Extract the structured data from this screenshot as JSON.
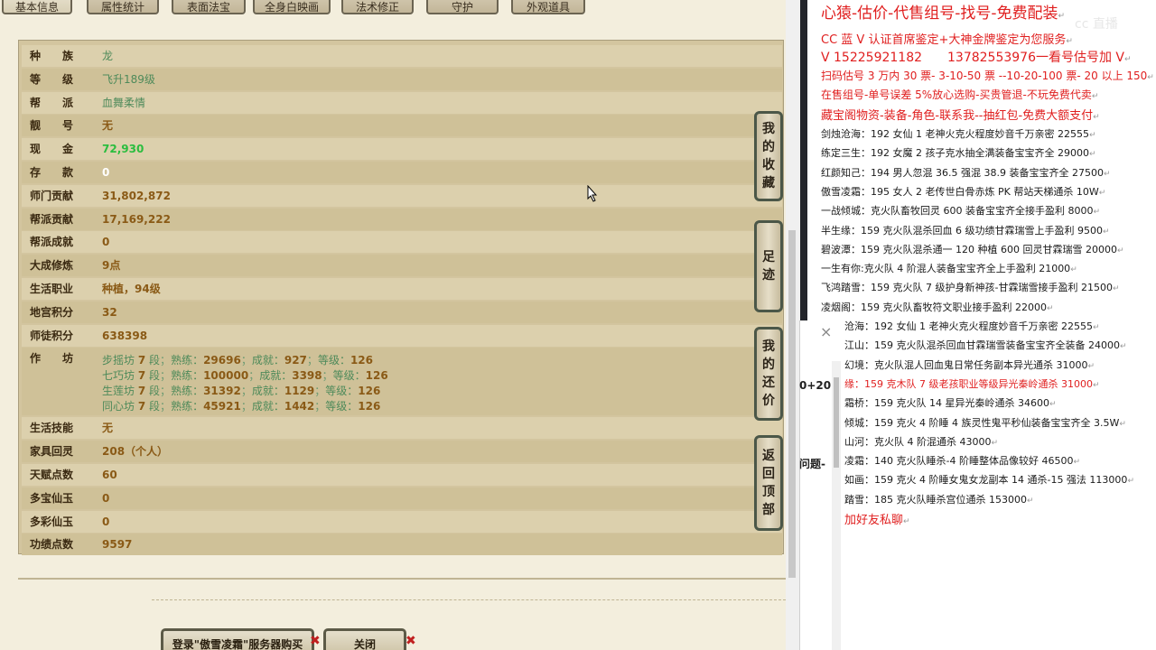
{
  "tabs": [
    "基本信息",
    "属性统计",
    "表面法宝",
    "全身白映画",
    "法术修正",
    "守护",
    "外观道具"
  ],
  "stats": [
    {
      "label": "种　　族",
      "value": "龙",
      "style": "teal"
    },
    {
      "label": "等　　级",
      "value": "飞升189级",
      "style": "teal"
    },
    {
      "label": "帮　　派",
      "value": "血舞柔情",
      "style": "teal"
    },
    {
      "label": "靓　　号",
      "value": "无",
      "style": "brown"
    },
    {
      "label": "现　　金",
      "value": "72,930",
      "style": "green"
    },
    {
      "label": "存　　款",
      "value": "0",
      "style": "white"
    },
    {
      "label": "师门贡献",
      "value": "31,802,872",
      "style": "brown"
    },
    {
      "label": "帮派贡献",
      "value": "17,169,222",
      "style": "brown"
    },
    {
      "label": "帮派成就",
      "value": "0",
      "style": "brown"
    },
    {
      "label": "大成修炼",
      "value": "9点",
      "style": "brown"
    },
    {
      "label": "生活职业",
      "value": "种植，94级",
      "style": "brown"
    },
    {
      "label": "地宫积分",
      "value": "32",
      "style": "brown"
    },
    {
      "label": "师徒积分",
      "value": "638398",
      "style": "brown"
    }
  ],
  "workshop": {
    "label": "作　　坊",
    "lines": [
      {
        "name": "步摇坊",
        "dan": "7",
        "shulian": "29696",
        "chengjiu": "927",
        "dengji": "126"
      },
      {
        "name": "七巧坊",
        "dan": "7",
        "shulian": "100000",
        "chengjiu": "3398",
        "dengji": "126"
      },
      {
        "name": "生莲坊",
        "dan": "7",
        "shulian": "31392",
        "chengjiu": "1129",
        "dengji": "126"
      },
      {
        "name": "同心坊",
        "dan": "7",
        "shulian": "45921",
        "chengjiu": "1442",
        "dengji": "126"
      }
    ],
    "word_dan": "段",
    "word_shulian": "熟练：",
    "word_chengjiu": "成就：",
    "word_dengji": "等级："
  },
  "stats2": [
    {
      "label": "生活技能",
      "value": "无"
    },
    {
      "label": "家具回灵",
      "value": "208（个人）"
    },
    {
      "label": "天赋点数",
      "value": "60"
    },
    {
      "label": "多宝仙玉",
      "value": "0"
    },
    {
      "label": "多彩仙玉",
      "value": "0"
    },
    {
      "label": "功绩点数",
      "value": "9597"
    }
  ],
  "side_buttons": [
    {
      "name": "my-favorites-button",
      "text": [
        "我",
        "的",
        "收",
        "藏"
      ]
    },
    {
      "name": "footprint-button",
      "text": [
        "足",
        "迹"
      ]
    },
    {
      "name": "my-counteroffer-button",
      "text": [
        "我",
        "的",
        "还",
        "价"
      ]
    },
    {
      "name": "back-to-top-button",
      "text": [
        "返",
        "回",
        "顶",
        "部"
      ]
    }
  ],
  "bottom": {
    "buy_label": "登录\"傲雪凌霜\"服务器购买",
    "close_label": "关闭"
  },
  "dialog": {
    "close": "×",
    "frag1": "0+20",
    "frag2": "问题-"
  },
  "ad": {
    "watermark": "cc 直播",
    "headlines": [
      "心猿-估价-代售组号-找号-免费配装",
      "CC 蓝 V 认证首席鉴定+大神金牌鉴定为您服务",
      "V 15225921182　　13782553976一看号估号加 V",
      "扫码估号 3 万内 30 票- 3-10-50 票 --10-20-100 票- 20 以上 150",
      "在售组号-单号误差 5%放心选购-买贵管退-不玩免费代卖",
      "藏宝阁物资-装备-角色-联系我--抽红包-免费大额支付"
    ],
    "listings": [
      {
        "text": "剑烛沧海：192 女仙 1 老神火克火程度妙音千万亲密 22555",
        "red": false
      },
      {
        "text": "练定三生：192 女魔 2 孩子克水抽全满装备宝宝齐全 29000",
        "red": false
      },
      {
        "text": "红颜知己：194 男人忽混 36.5 强混 38.9 装备宝宝齐全 27500",
        "red": false
      },
      {
        "text": "傲雪凌霜：195 女人 2 老传世白骨赤炼 PK 帮站天梯通杀 10W",
        "red": false
      },
      {
        "text": "一战倾城：克火队畜牧回灵 600 装备宝宝齐全接手盈利 8000",
        "red": false
      },
      {
        "text": "半生缘：159 克火队混杀回血 6 级功绩甘霖瑞雪上手盈利 9500",
        "red": false
      },
      {
        "text": "碧波潭：159 克火队混杀通一 120 种植 600 回灵甘霖瑞雪 20000",
        "red": false
      },
      {
        "text": "一生有你:克火队 4 阶混人装备宝宝齐全上手盈利 21000",
        "red": false
      },
      {
        "text": "飞鸿踏雪：159 克火队 7 级护身新神孩-甘霖瑞雪接手盈利 21500",
        "red": false
      },
      {
        "text": "凌烟阁：159 克火队畜牧符文职业接手盈利 22000",
        "red": false
      },
      {
        "text": "沧海：192 女仙 1 老神火克火程度妙音千万亲密 22555",
        "red": false
      },
      {
        "text": "江山：159 克火队混杀回血甘霖瑞雪装备宝宝齐全装备 24000",
        "red": false
      },
      {
        "text": "幻境：克火队混人回血鬼日常任务副本异光通杀 31000",
        "red": false
      },
      {
        "text": "缘：159 克木队 7 级老孩职业等级异光秦岭通杀 31000",
        "red": true
      },
      {
        "text": "霜桥：159 克火队 14 星异光秦岭通杀 34600",
        "red": false
      },
      {
        "text": "倾城：159 克火 4 阶睡 4 族灵性鬼平秒仙装备宝宝齐全 3.5W",
        "red": false
      },
      {
        "text": "山河：克火队 4 阶混通杀 43000",
        "red": false
      },
      {
        "text": "凌霜：140 克火队睡杀-4 阶睡整体品像较好 46500",
        "red": false
      },
      {
        "text": "如画：159 克火 4 阶睡女鬼女龙副本 14 通杀-15 强法 113000",
        "red": false
      },
      {
        "text": "踏雪：185 克火队睡杀宫位通杀 153000",
        "red": false
      }
    ],
    "footer": "加好友私聊"
  }
}
